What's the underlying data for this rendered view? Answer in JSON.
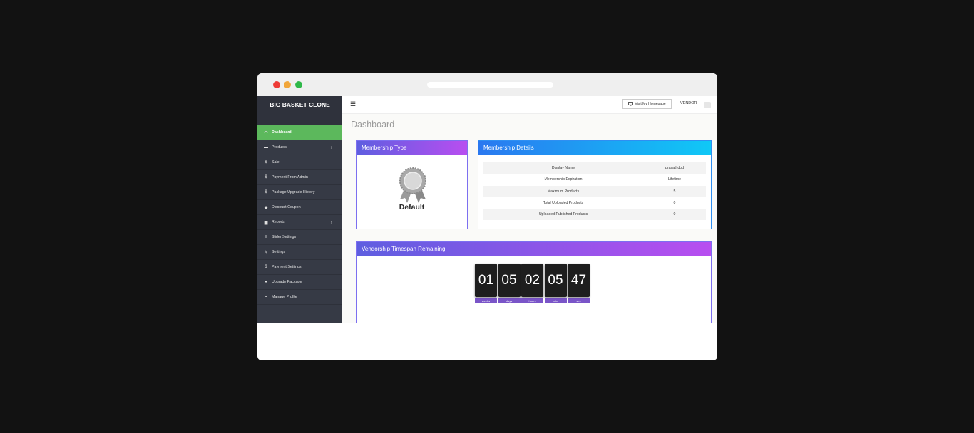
{
  "window": {
    "traffic_lights": [
      "#ee3b36",
      "#f1a63b",
      "#2fb849"
    ]
  },
  "sidebar": {
    "brand": "BIG BASKET CLONE",
    "items": [
      {
        "label": "Dashboard",
        "icon": "dashboard-icon",
        "active": true
      },
      {
        "label": "Products",
        "icon": "cart-icon",
        "has_submenu": true
      },
      {
        "label": "Sale",
        "icon": "dollar-icon"
      },
      {
        "label": "Payment From Admin",
        "icon": "dollar-icon"
      },
      {
        "label": "Package Upgrade History",
        "icon": "dollar-icon"
      },
      {
        "label": "Discount Coupon",
        "icon": "tag-icon"
      },
      {
        "label": "Reports",
        "icon": "file-icon",
        "has_submenu": true
      },
      {
        "label": "Slider Settings",
        "icon": "sliders-icon"
      },
      {
        "label": "Settings",
        "icon": "wrench-icon"
      },
      {
        "label": "Payment Settings",
        "icon": "dollar-icon"
      },
      {
        "label": "Upgrade Package",
        "icon": "upgrade-icon"
      },
      {
        "label": "Manage Profile",
        "icon": "lock-icon"
      }
    ]
  },
  "header": {
    "visit_label": "Visit My Homepage",
    "role_label": "VENDOR"
  },
  "page": {
    "title": "Dashboard"
  },
  "membership_type": {
    "title": "Membership Type",
    "package": "Default"
  },
  "membership_details": {
    "title": "Membership Details",
    "rows": [
      {
        "label": "Display Name",
        "value": "prasathdod"
      },
      {
        "label": "Membership Expiration",
        "value": "Lifetime"
      },
      {
        "label": "Maximum Products",
        "value": "5"
      },
      {
        "label": "Total Uploaded Products",
        "value": "0"
      },
      {
        "label": "Uploaded Published Products",
        "value": "0"
      }
    ]
  },
  "timespan": {
    "title": "Vendorship Timespan Remaining",
    "units": [
      {
        "value": "01",
        "label": "weeks"
      },
      {
        "value": "05",
        "label": "days"
      },
      {
        "value": "02",
        "label": "hours"
      },
      {
        "value": "05",
        "label": "min"
      },
      {
        "value": "47",
        "label": "sec"
      }
    ]
  },
  "colors": {
    "sidebar_bg": "#363a45",
    "active_item": "#5cb85c",
    "purple_header_start": "#5e5ee0",
    "purple_header_end": "#b84ef0",
    "blue_header_start": "#2a78f0",
    "blue_header_end": "#10c8f6",
    "countdown_label": "#7a55c8"
  }
}
